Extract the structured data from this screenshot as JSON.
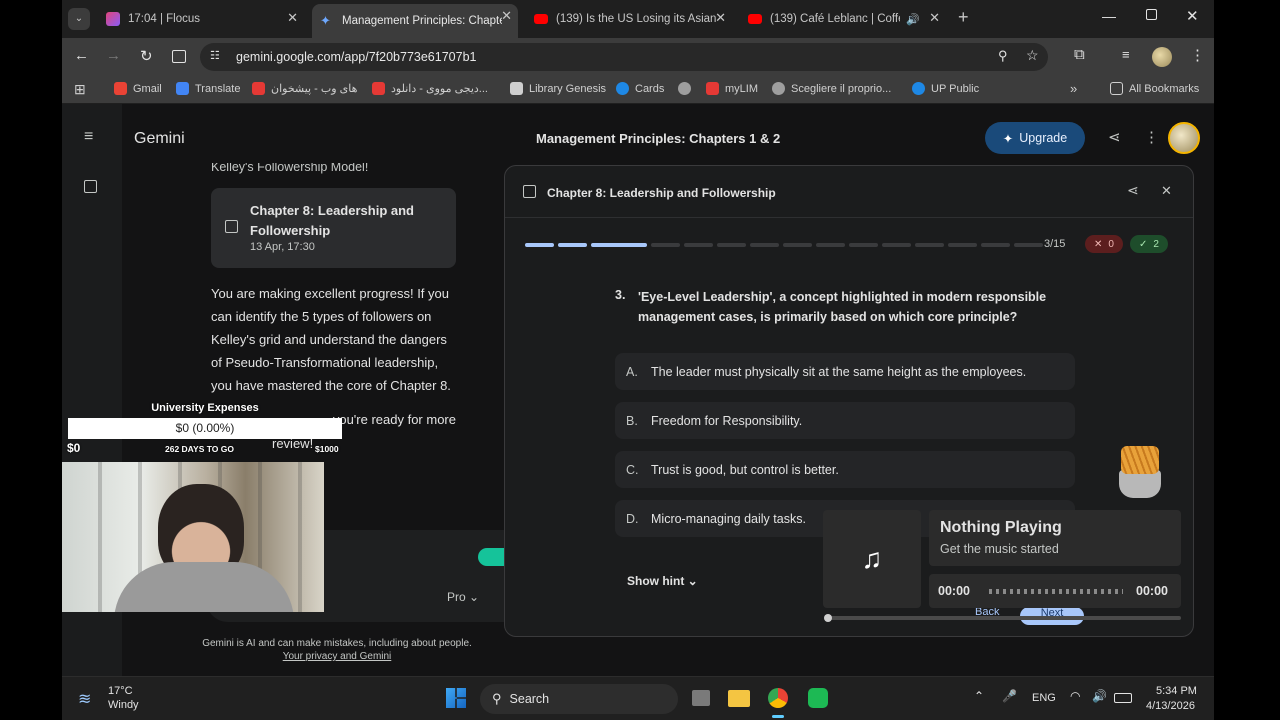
{
  "tabs": [
    {
      "title": "17:04 | Flocus",
      "color": "#e0457b"
    },
    {
      "title": "Management Principles: Chapte",
      "color": "#6ea8fe"
    },
    {
      "title": "(139) Is the US Losing its Asian",
      "color": "#ff0000"
    },
    {
      "title": "(139) Café Leblanc | Coffee",
      "color": "#ff0000"
    }
  ],
  "url": "gemini.google.com/app/7f20b773e61707b1",
  "bookmarks": [
    {
      "label": "Gmail",
      "color": "#ea4335"
    },
    {
      "label": "Translate",
      "color": "#4285f4"
    },
    {
      "label": "های وب - پیشخوان",
      "color": "#e53935"
    },
    {
      "label": "دیجی مووی - دانلود...",
      "color": "#e53935"
    },
    {
      "label": "Library Genesis",
      "color": "#cfcfcf"
    },
    {
      "label": "Cards",
      "color": "#1e88e5"
    },
    {
      "label": "",
      "color": "#9e9e9e"
    },
    {
      "label": "myLIM",
      "color": "#e53935"
    },
    {
      "label": "Scegliere il proprio...",
      "color": "#9e9e9e"
    },
    {
      "label": "UP Public",
      "color": "#1e88e5"
    }
  ],
  "all_bookmarks": "All Bookmarks",
  "app": {
    "name": "Gemini",
    "chat_title": "Management Principles: Chapters 1 & 2",
    "upgrade": "Upgrade"
  },
  "chat": {
    "cut_text": "Kelley's Followership Model!",
    "card_title": "Chapter 8: Leadership and Followership",
    "card_date": "13 Apr, 17:30",
    "message": "You are making excellent progress! If you can identify the 5 types of followers on Kelley's grid and understand the dangers of Pseudo-Transformational leadership, you have mastered the core of Chapter 8.",
    "message2": "...you're ready for more",
    "message3": "review!",
    "model": "Pro",
    "disclaimer": "Gemini is AI and can make mistakes, including about people.",
    "privacy": "Your privacy and Gemini"
  },
  "widget": {
    "title": "University Expenses",
    "value": "$0 (0.00%)",
    "min": "$0",
    "days": "262 DAYS TO GO",
    "max": "$1000",
    "progress": 0
  },
  "quiz": {
    "header": "Chapter 8: Leadership and Followership",
    "progress_text": "3/15",
    "current": 3,
    "total": 15,
    "wrong": "0",
    "right": "2",
    "q_num": "3.",
    "question": "'Eye-Level Leadership', a concept highlighted in modern responsible management cases, is primarily based on which core principle?",
    "options": [
      {
        "letter": "A.",
        "text": "The leader must physically sit at the same height as the employees."
      },
      {
        "letter": "B.",
        "text": "Freedom for Responsibility."
      },
      {
        "letter": "C.",
        "text": "Trust is good, but control is better."
      },
      {
        "letter": "D.",
        "text": "Micro-managing daily tasks."
      }
    ],
    "hint": "Show hint",
    "back": "Back",
    "next": "Next"
  },
  "music": {
    "title": "Nothing Playing",
    "subtitle": "Get the music started",
    "time_start": "00:00",
    "time_end": "00:00"
  },
  "taskbar": {
    "temp": "17°C",
    "weather": "Windy",
    "search": "Search",
    "lang": "ENG",
    "time": "5:34 PM",
    "date": "4/13/2026"
  }
}
